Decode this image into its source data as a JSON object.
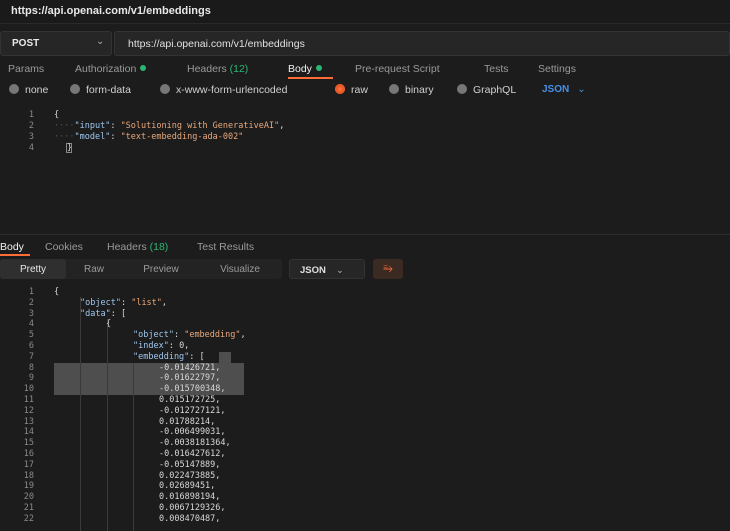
{
  "window": {
    "title": "https://api.openai.com/v1/embeddings"
  },
  "request": {
    "method": "POST",
    "url": "https://api.openai.com/v1/embeddings",
    "tabs": [
      {
        "label": "Params"
      },
      {
        "label": "Authorization"
      },
      {
        "label": "Headers",
        "count": "(12)"
      },
      {
        "label": "Body"
      },
      {
        "label": "Pre-request Script"
      },
      {
        "label": "Tests"
      },
      {
        "label": "Settings"
      }
    ],
    "body_types": [
      "none",
      "form-data",
      "x-www-form-urlencoded",
      "raw",
      "binary",
      "GraphQL"
    ],
    "selected_body_type": "raw",
    "raw_format": "JSON",
    "line_numbers": [
      "1",
      "2",
      "3",
      "4"
    ],
    "body": {
      "open": "{",
      "input_key": "\"input\"",
      "input_value": "\"Solutioning with GenerativeAI\"",
      "model_key": "\"model\"",
      "model_value": "\"text-embedding-ada-002\"",
      "close": "}"
    }
  },
  "response": {
    "tabs": [
      {
        "label": "Body"
      },
      {
        "label": "Cookies"
      },
      {
        "label": "Headers",
        "count": "(18)"
      },
      {
        "label": "Test Results"
      }
    ],
    "view_modes": [
      "Pretty",
      "Raw",
      "Preview",
      "Visualize"
    ],
    "format": "JSON",
    "line_numbers": [
      "1",
      "2",
      "3",
      "4",
      "5",
      "6",
      "7",
      "8",
      "9",
      "10",
      "11",
      "12",
      "13",
      "14",
      "15",
      "16",
      "17",
      "18",
      "19",
      "20",
      "21",
      "22"
    ],
    "lines": {
      "l1": "{",
      "object_key": "\"object\"",
      "object_value": "\"list\"",
      "data_key": "\"data\"",
      "data_open": "[",
      "item_open": "{",
      "item_object_key": "\"object\"",
      "item_object_value": "\"embedding\"",
      "index_key": "\"index\"",
      "index_value": "0",
      "embedding_key": "\"embedding\"",
      "embedding_open": "["
    },
    "embedding_values": [
      "-0.01426721,",
      "-0.01622797,",
      "-0.015700348,",
      "0.015172725,",
      "-0.012727121,",
      "0.01788214,",
      "-0.006499031,",
      "-0.0038181364,",
      "-0.016427612,",
      "-0.05147889,",
      "0.022473885,",
      "0.02689451,",
      "0.016898194,",
      "0.0067129326,",
      "0.008470487,"
    ]
  },
  "colors": {
    "accent": "#ff6c37",
    "success": "#2bb673",
    "link": "#4a8fe7"
  }
}
